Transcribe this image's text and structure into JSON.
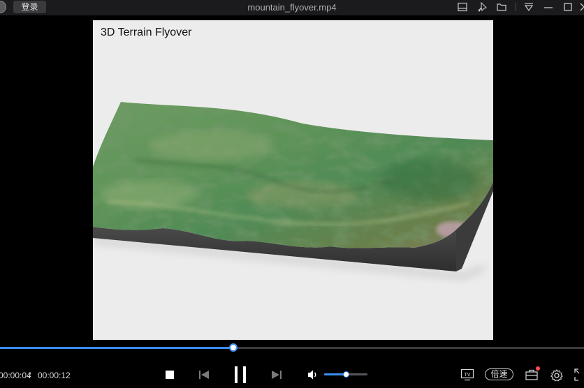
{
  "titlebar": {
    "login_label": "登录",
    "file_title": "mountain_flyover.mp4",
    "icons": [
      "mini-mode-icon",
      "pin-icon",
      "folder-icon",
      "menu-icon",
      "minimize-icon",
      "maximize-icon",
      "close-icon"
    ]
  },
  "video": {
    "title": "3D Terrain Flyover"
  },
  "playback": {
    "current_time": "00:00:04",
    "separator": "/",
    "total_time": "00:00:12",
    "progress": 0.4,
    "volume": 0.5,
    "speed_label": "倍速",
    "accent_color": "#3a8ef0"
  }
}
